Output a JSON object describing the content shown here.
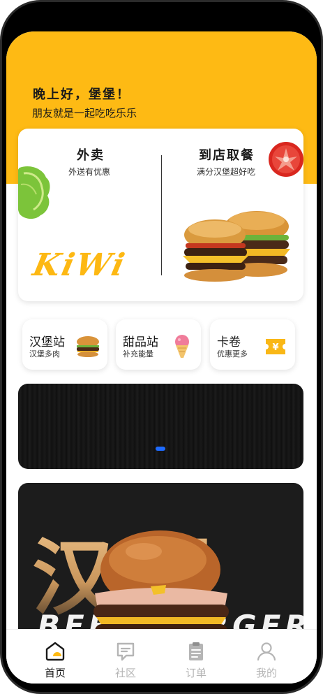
{
  "header": {
    "greeting": "晚上好，堡堡！",
    "subtitle": "朋友就是一起吃吃乐乐"
  },
  "services": {
    "delivery": {
      "title": "外卖",
      "subtitle": "外送有优惠"
    },
    "pickup": {
      "title": "到店取餐",
      "subtitle": "满分汉堡超好吃"
    },
    "brand": "KiWi"
  },
  "shortcuts": [
    {
      "title": "汉堡站",
      "subtitle": "汉堡多肉",
      "icon": "burger-icon"
    },
    {
      "title": "甜品站",
      "subtitle": "补充能量",
      "icon": "ice-cream-icon"
    },
    {
      "title": "卡卷",
      "subtitle": "优惠更多",
      "icon": "coupon-icon"
    }
  ],
  "promo": {
    "big_text": "汉堡",
    "english_text": "BEEF BURGER"
  },
  "tabbar": {
    "items": [
      {
        "label": "首页",
        "icon": "home-icon",
        "active": true
      },
      {
        "label": "社区",
        "icon": "chat-icon",
        "active": false
      },
      {
        "label": "订单",
        "icon": "clipboard-icon",
        "active": false
      },
      {
        "label": "我的",
        "icon": "user-icon",
        "active": false
      }
    ]
  },
  "colors": {
    "accent": "#FEBA14",
    "carousel_dot": "#1E6BFF",
    "tab_active": "#1a1a1a",
    "tab_inactive": "#b5b5b5"
  }
}
